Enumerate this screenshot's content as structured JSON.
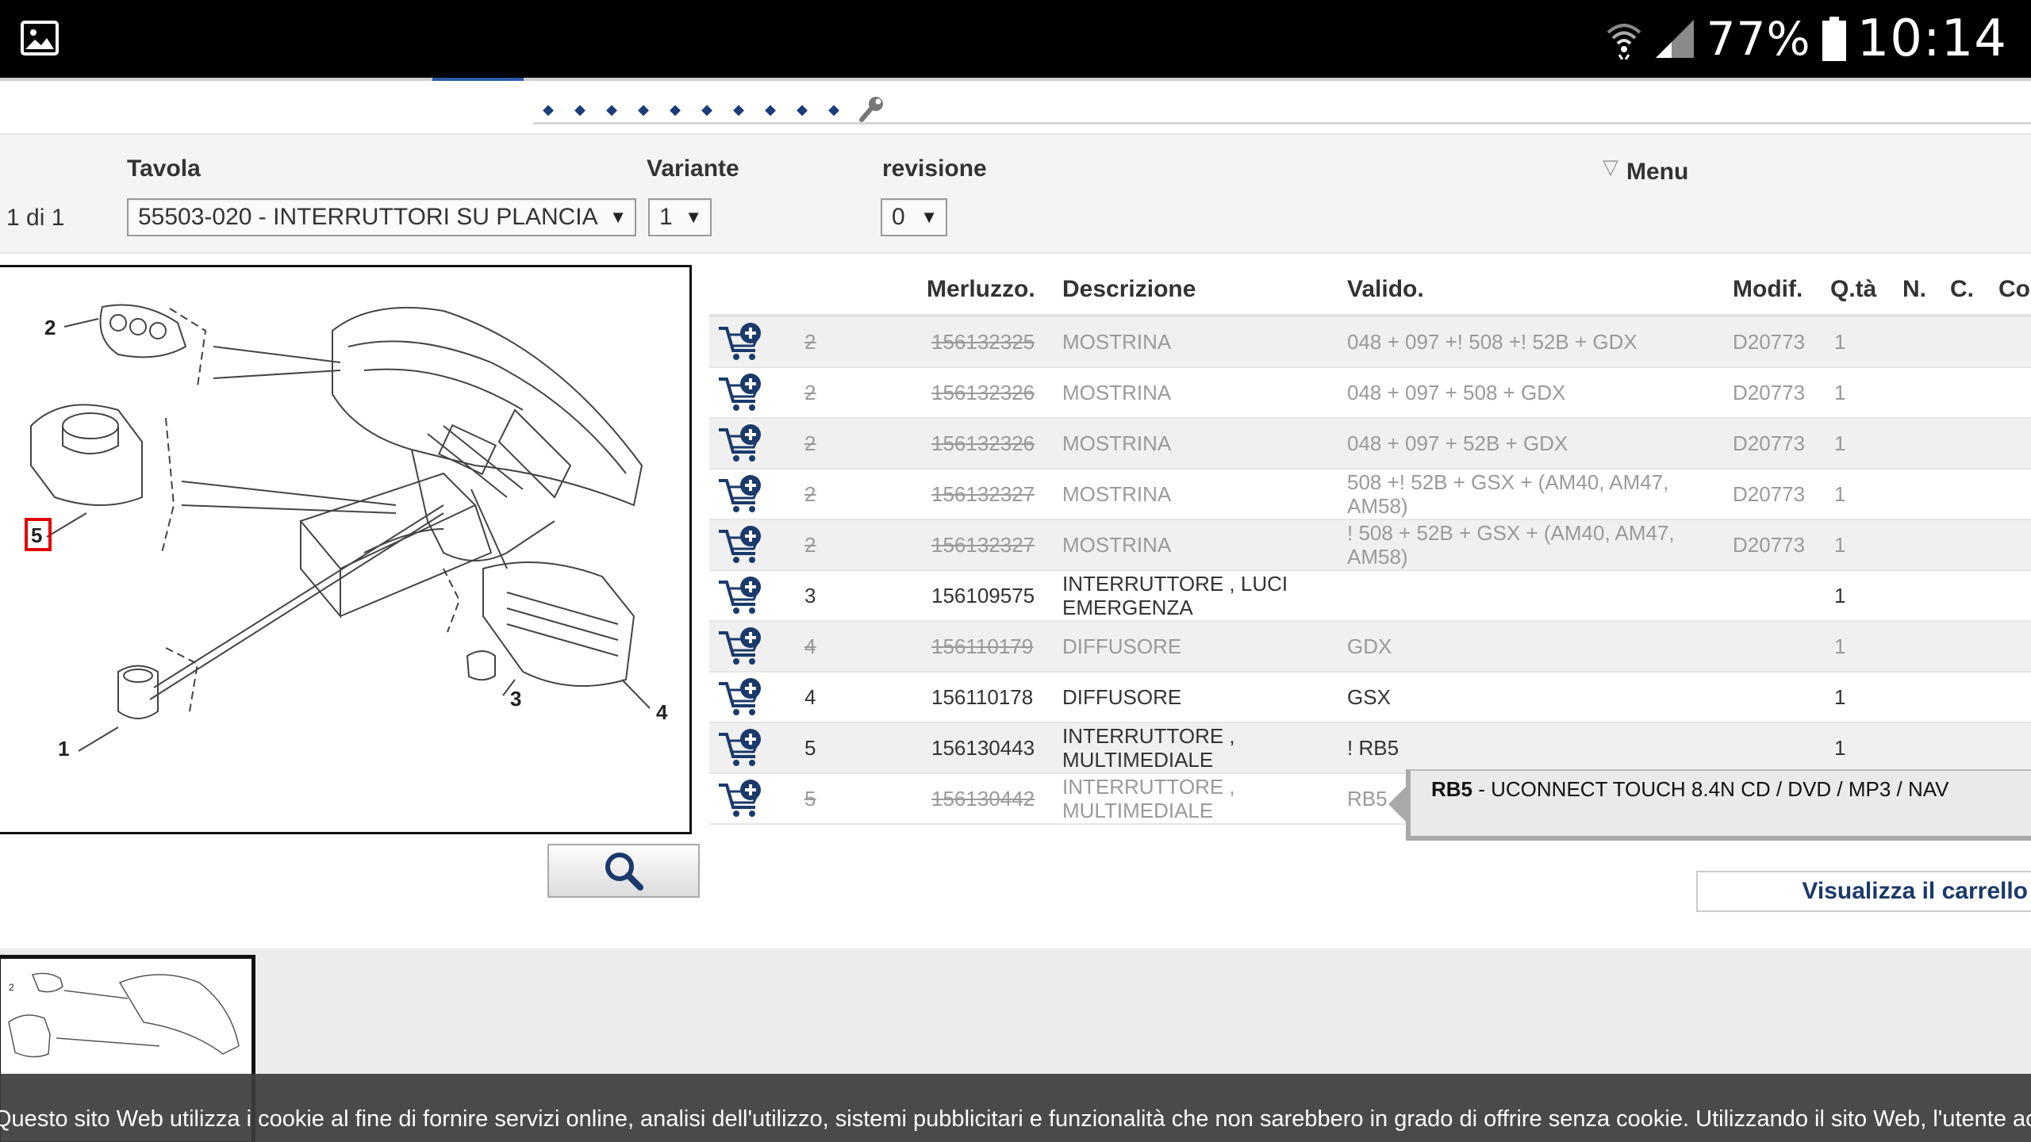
{
  "status_bar": {
    "battery": "77%",
    "time": "10:14",
    "icons": [
      "gallery-icon",
      "wifi-icon",
      "signal-icon",
      "battery-icon"
    ]
  },
  "header": {
    "nav_dot_count": 10,
    "tool_icon": "wrench-icon"
  },
  "selectors": {
    "pager": "1 di 1",
    "tavola_label": "Tavola",
    "tavola_value": "55503-020 - INTERRUTTORI SU PLANCIA",
    "variante_label": "Variante",
    "variante_value": "1",
    "revisione_label": "revisione",
    "revisione_value": "0",
    "menu_label": "Menu"
  },
  "diagram": {
    "callouts": [
      "2",
      "5",
      "1",
      "3",
      "4"
    ],
    "highlighted_callout": "5",
    "zoom_icon": "magnifier-icon"
  },
  "parts_table": {
    "headers": {
      "code": "Merluzzo.",
      "description": "Descrizione",
      "valid": "Valido.",
      "modif": "Modif.",
      "qty": "Q.tà",
      "n": "N.",
      "c": "C.",
      "co": "Co"
    },
    "rows": [
      {
        "ref": "2",
        "code": "156132325",
        "description": "MOSTRINA",
        "valid": "048 + 097 +! 508 +! 52B + GDX",
        "modif": "D20773",
        "qty": "1"
      },
      {
        "ref": "2",
        "code": "156132326",
        "description": "MOSTRINA",
        "valid": "048 + 097 + 508 + GDX",
        "modif": "D20773",
        "qty": "1"
      },
      {
        "ref": "2",
        "code": "156132326",
        "description": "MOSTRINA",
        "valid": "048 + 097 + 52B + GDX",
        "modif": "D20773",
        "qty": "1"
      },
      {
        "ref": "2",
        "code": "156132327",
        "description": "MOSTRINA",
        "valid": "508 +! 52B + GSX + (AM40, AM47, AM58)",
        "modif": "D20773",
        "qty": "1"
      },
      {
        "ref": "2",
        "code": "156132327",
        "description": "MOSTRINA",
        "valid": "! 508 + 52B + GSX + (AM40, AM47, AM58)",
        "modif": "D20773",
        "qty": "1"
      },
      {
        "ref": "3",
        "code": "156109575",
        "description": "INTERRUTTORE , LUCI EMERGENZA",
        "valid": "",
        "modif": "",
        "qty": "1"
      },
      {
        "ref": "4",
        "code": "156110179",
        "description": "DIFFUSORE",
        "valid": "GDX",
        "modif": "",
        "qty": "1"
      },
      {
        "ref": "4",
        "code": "156110178",
        "description": "DIFFUSORE",
        "valid": "GSX",
        "modif": "",
        "qty": "1"
      },
      {
        "ref": "5",
        "code": "156130443",
        "description": "INTERRUTTORE , MULTIMEDIALE",
        "valid": "! RB5",
        "modif": "",
        "qty": "1"
      },
      {
        "ref": "5",
        "code": "156130442",
        "description": "INTERRUTTORE , MULTIMEDIALE",
        "valid": "RB5",
        "modif": "",
        "qty": ""
      }
    ],
    "row_states": [
      "obsolete",
      "obsolete",
      "obsolete",
      "obsolete",
      "obsolete",
      "current",
      "obsolete",
      "current",
      "current",
      "obsolete"
    ]
  },
  "tooltip": {
    "code": "RB5",
    "text": " - UCONNECT TOUCH 8.4N CD / DVD / MP3 / NAV"
  },
  "cart_link": "Visualizza il carrello",
  "cookie_banner": "Questo sito Web utilizza i cookie al fine di fornire servizi online, analisi dell'utilizzo, sistemi pubblicitari e funzionalità che non sarebbero in grado di offrire senza cookie. Utilizzando il sito Web, l'utente accett",
  "colors": {
    "status_bar": "#000000",
    "link_blue": "#1b3a6b",
    "obsolete_text": "#9a9a9a",
    "highlight_red": "#e00000"
  }
}
